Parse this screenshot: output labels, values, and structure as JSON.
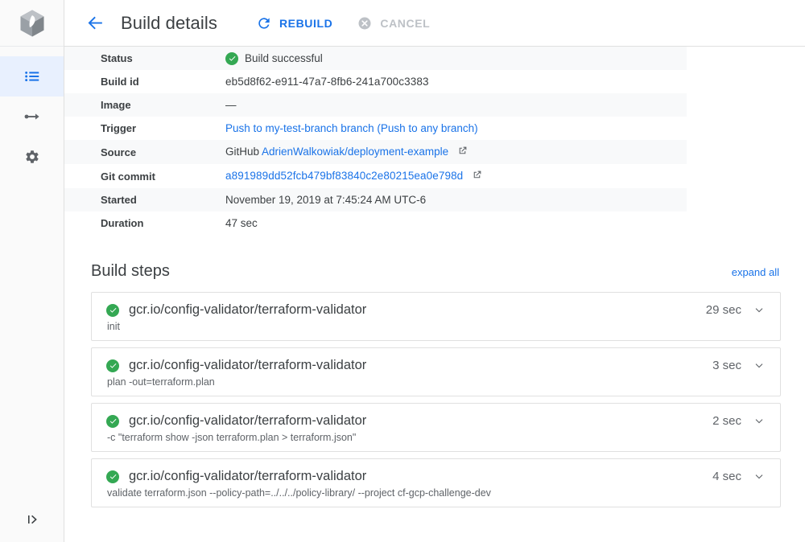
{
  "rail": {
    "logo_icon": "cloud-build-cube-logo",
    "items": [
      {
        "icon": "list-icon",
        "name": "history",
        "active": true
      },
      {
        "icon": "trigger-arrow-icon",
        "name": "triggers",
        "active": false
      },
      {
        "icon": "gear-icon",
        "name": "settings",
        "active": false
      }
    ],
    "expand_icon": "expand-panel-icon"
  },
  "header": {
    "back_icon": "back-arrow-icon",
    "title": "Build details",
    "rebuild_label": "REBUILD",
    "rebuild_icon": "refresh-icon",
    "cancel_label": "CANCEL",
    "cancel_icon": "cancel-circle-icon"
  },
  "details": {
    "rows": [
      {
        "key": "Status",
        "value": "Build successful",
        "type": "status"
      },
      {
        "key": "Build id",
        "value": "eb5d8f62-e911-47a7-8fb6-241a700c3383",
        "type": "text"
      },
      {
        "key": "Image",
        "value": "—",
        "type": "text"
      },
      {
        "key": "Trigger",
        "value": "Push to my-test-branch branch (Push to any branch)",
        "type": "link"
      },
      {
        "key": "Source",
        "prefix": "GitHub ",
        "value": "AdrienWalkowiak/deployment-example",
        "type": "link-ext"
      },
      {
        "key": "Git commit",
        "value": "a891989dd52fcb479bf83840c2e80215ea0e798d",
        "type": "link-ext"
      },
      {
        "key": "Started",
        "value": "November 19, 2019 at 7:45:24 AM UTC-6",
        "type": "text"
      },
      {
        "key": "Duration",
        "value": "47 sec",
        "type": "text"
      }
    ]
  },
  "build_steps": {
    "title": "Build steps",
    "expand_all_label": "expand all",
    "steps": [
      {
        "status_icon": "check-circle-icon",
        "name": "gcr.io/config-validator/terraform-validator",
        "args": "init",
        "duration": "29 sec",
        "chevron_icon": "chevron-down-icon"
      },
      {
        "status_icon": "check-circle-icon",
        "name": "gcr.io/config-validator/terraform-validator",
        "args": "plan -out=terraform.plan",
        "duration": "3 sec",
        "chevron_icon": "chevron-down-icon"
      },
      {
        "status_icon": "check-circle-icon",
        "name": "gcr.io/config-validator/terraform-validator",
        "args": "-c \"terraform show -json terraform.plan > terraform.json\"",
        "duration": "2 sec",
        "chevron_icon": "chevron-down-icon"
      },
      {
        "status_icon": "check-circle-icon",
        "name": "gcr.io/config-validator/terraform-validator",
        "args": "validate terraform.json --policy-path=../../../policy-library/ --project cf-gcp-challenge-dev",
        "duration": "4 sec",
        "chevron_icon": "chevron-down-icon"
      }
    ]
  },
  "colors": {
    "accent_blue": "#1a73e8",
    "success_green": "#34a853",
    "disabled_gray": "#bdc1c6",
    "row_shade": "#f8f9fa",
    "rail_active": "#e8f0fe"
  }
}
